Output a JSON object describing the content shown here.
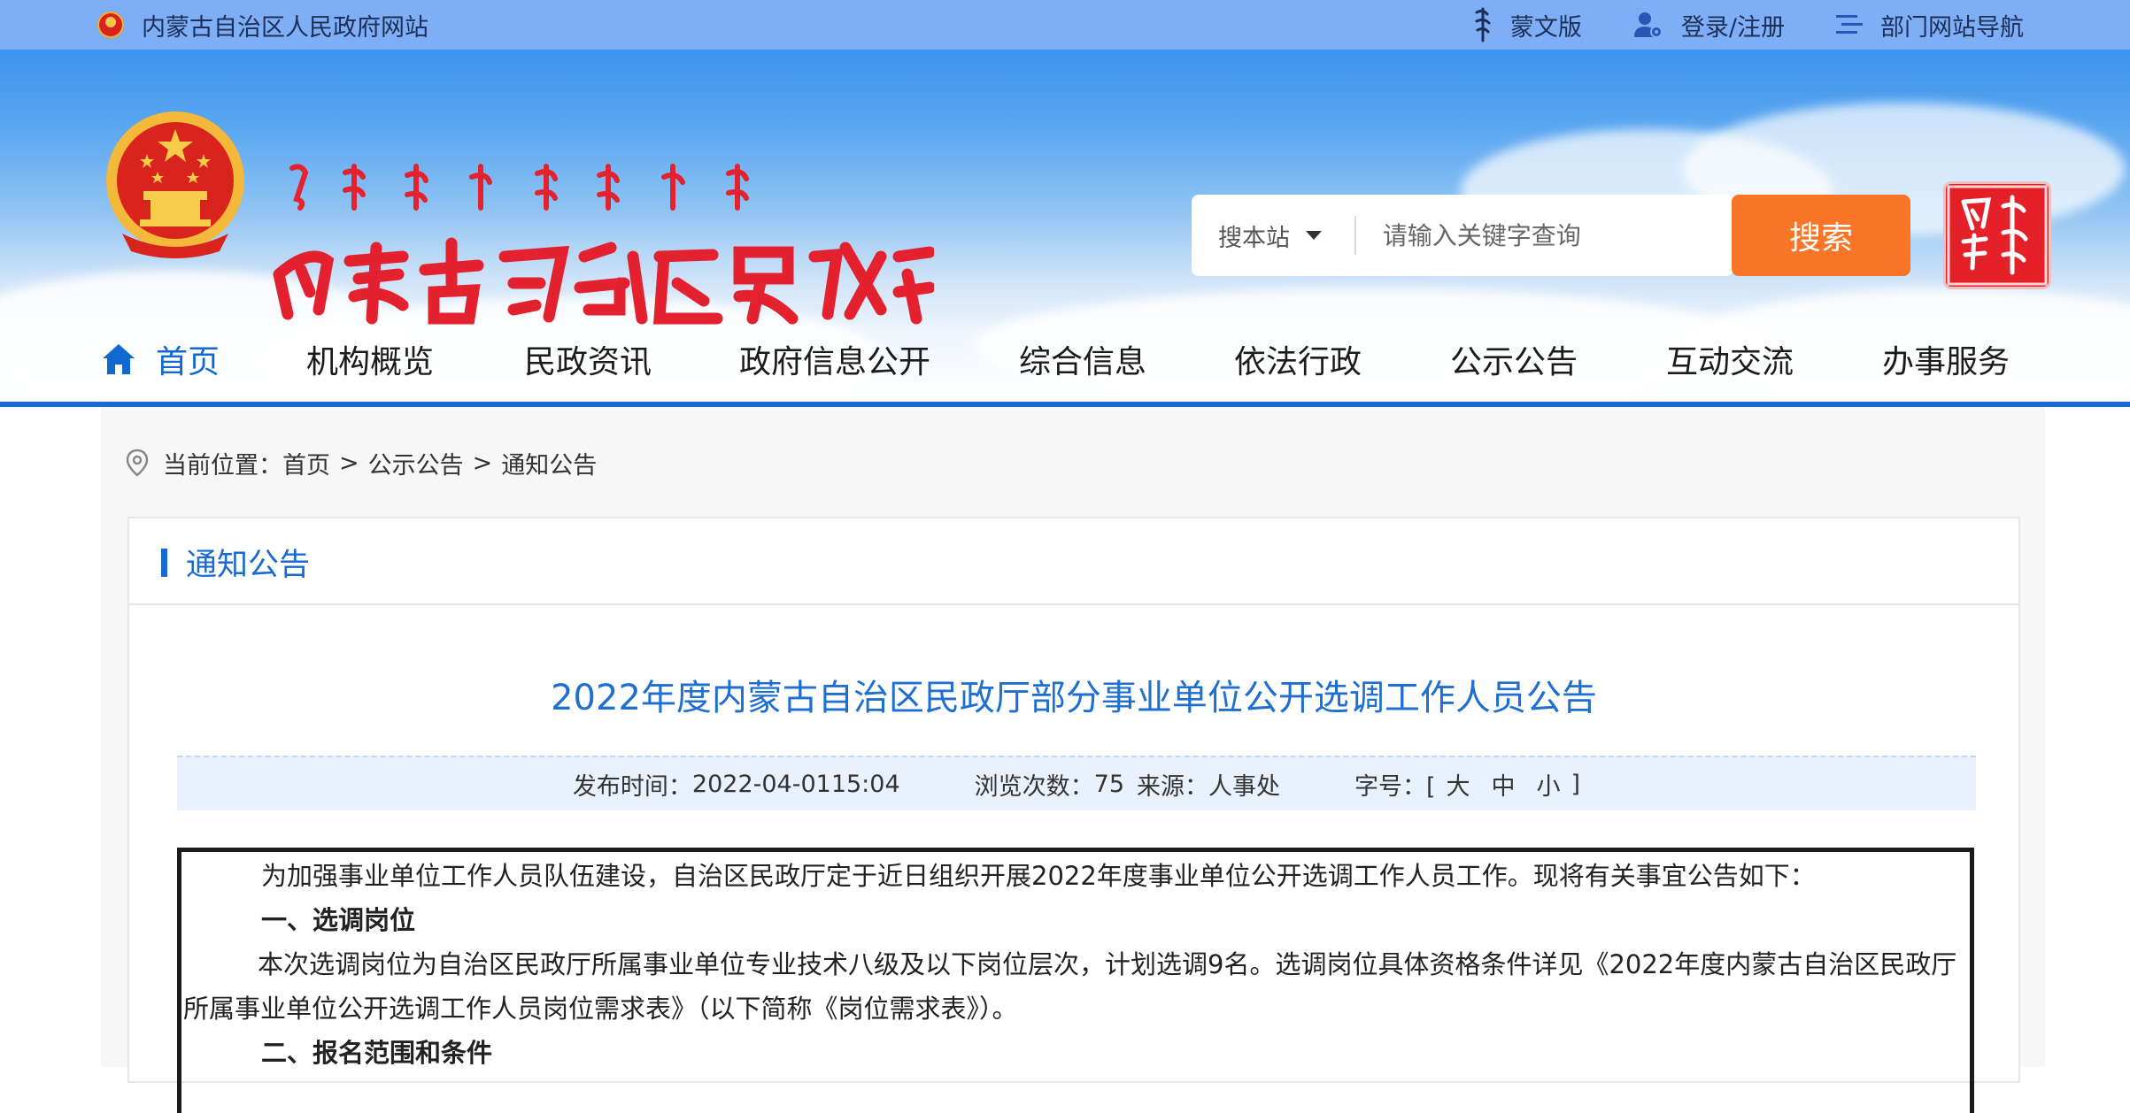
{
  "topbar": {
    "site_name": "内蒙古自治区人民政府网站",
    "mongolian_version": "蒙文版",
    "login": "登录/注册",
    "dept_nav": "部门网站导航"
  },
  "search": {
    "scope": "搜本站",
    "placeholder": "请输入关键字查询",
    "button": "搜索"
  },
  "nav": {
    "items": [
      "首页",
      "机构概览",
      "民政资讯",
      "政府信息公开",
      "综合信息",
      "依法行政",
      "公示公告",
      "互动交流",
      "办事服务"
    ]
  },
  "breadcrumb": {
    "prefix": "当前位置：",
    "items": [
      "首页",
      "公示公告",
      "通知公告"
    ],
    "sep": ">"
  },
  "panel": {
    "title": "通知公告"
  },
  "article": {
    "title": "2022年度内蒙古自治区民政厅部分事业单位公开选调工作人员公告",
    "publish_label": "发布时间：",
    "publish_time": "2022-04-0115:04",
    "views_label": "浏览次数：",
    "views": "75",
    "source_label": "来源：",
    "source": "人事处",
    "fontsize_label": "字号：[",
    "size_large": "大",
    "size_medium": "中",
    "size_small": "小",
    "fontsize_close": "]",
    "para1": "为加强事业单位工作人员队伍建设，自治区民政厅定于近日组织开展2022年度事业单位公开选调工作人员工作。现将有关事宜公告如下：",
    "heading1": "一、选调岗位",
    "para2": "本次选调岗位为自治区民政厅所属事业单位专业技术八级及以下岗位层次，计划选调9名。选调岗位具体资格条件详见《2022年度内蒙古自治区民政厅所属事业单位公开选调工作人员岗位需求表》（以下简称《岗位需求表》）。",
    "heading2": "二、报名范围和条件"
  }
}
